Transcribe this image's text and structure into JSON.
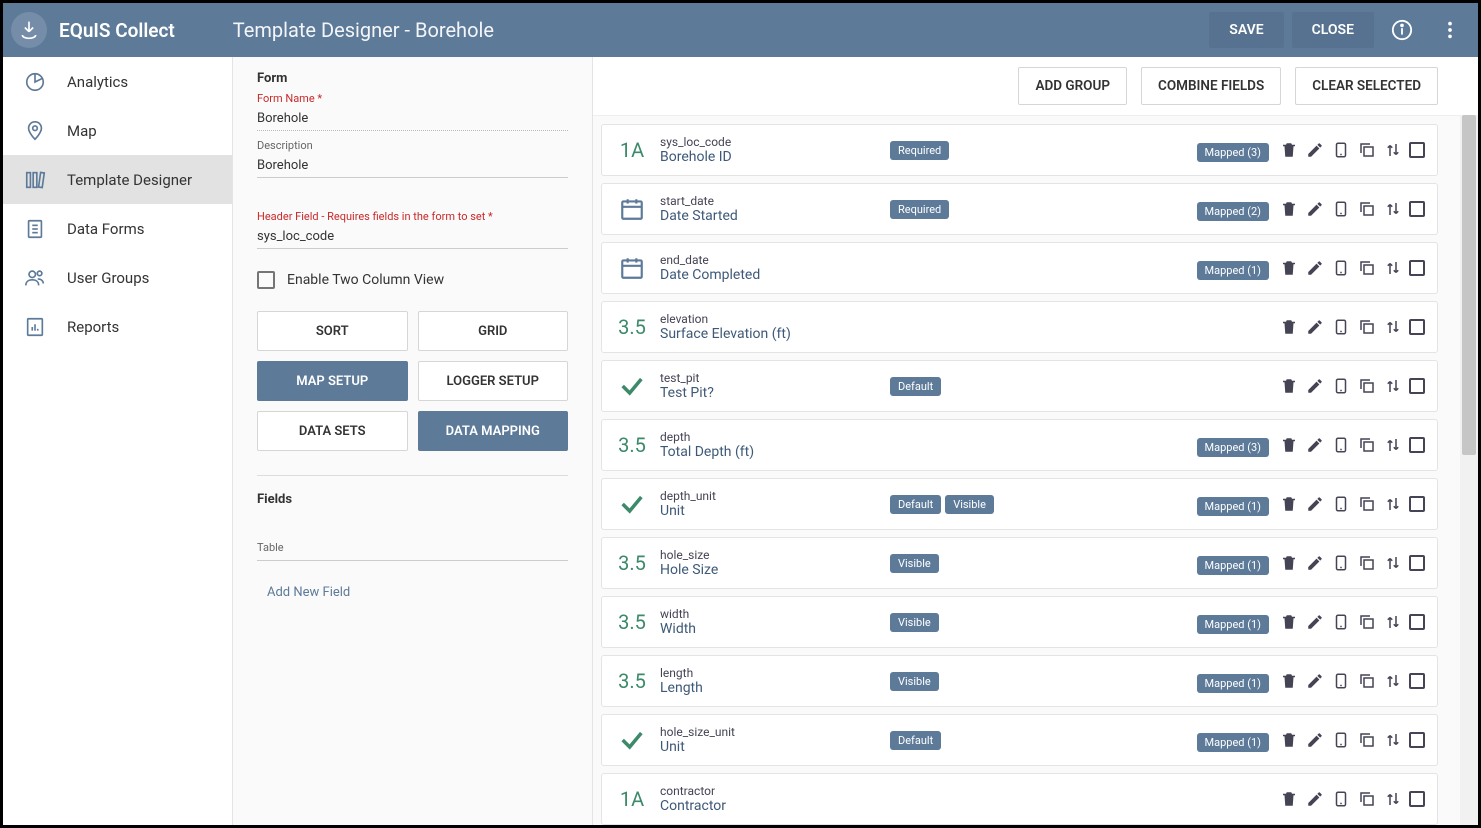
{
  "brand": "EQuIS Collect",
  "page_title": "Template Designer - Borehole",
  "top_actions": {
    "save": "SAVE",
    "close": "CLOSE"
  },
  "nav": [
    {
      "label": "Analytics",
      "icon": "pie"
    },
    {
      "label": "Map",
      "icon": "map"
    },
    {
      "label": "Template Designer",
      "icon": "templates",
      "active": true
    },
    {
      "label": "Data Forms",
      "icon": "forms"
    },
    {
      "label": "User Groups",
      "icon": "users"
    },
    {
      "label": "Reports",
      "icon": "reports"
    }
  ],
  "form": {
    "section": "Form",
    "name_label": "Form Name *",
    "name_value": "Borehole",
    "desc_label": "Description",
    "desc_value": "Borehole",
    "header_label": "Header Field - Requires fields in the form to set *",
    "header_value": "sys_loc_code",
    "twocol_label": "Enable Two Column View",
    "buttons": {
      "sort": "SORT",
      "grid": "GRID",
      "map_setup": "MAP SETUP",
      "logger_setup": "LOGGER SETUP",
      "data_sets": "DATA SETS",
      "data_mapping": "DATA MAPPING"
    },
    "fields_section": "Fields",
    "table_label": "Table",
    "add_field": "Add New Field"
  },
  "toolbar": {
    "add_group": "ADD GROUP",
    "combine": "COMBINE FIELDS",
    "clear": "CLEAR SELECTED"
  },
  "fields": [
    {
      "type": "1A",
      "code": "sys_loc_code",
      "caption": "Borehole ID",
      "tags": [
        "Required"
      ],
      "mapped": "Mapped  (3)"
    },
    {
      "type": "date",
      "code": "start_date",
      "caption": "Date Started",
      "tags": [
        "Required"
      ],
      "mapped": "Mapped  (2)"
    },
    {
      "type": "date",
      "code": "end_date",
      "caption": "Date Completed",
      "tags": [],
      "mapped": "Mapped  (1)"
    },
    {
      "type": "3.5",
      "code": "elevation",
      "caption": "Surface Elevation (ft)",
      "tags": [],
      "mapped": ""
    },
    {
      "type": "check",
      "code": "test_pit",
      "caption": "Test Pit?",
      "tags": [
        "Default"
      ],
      "mapped": ""
    },
    {
      "type": "3.5",
      "code": "depth",
      "caption": "Total Depth (ft)",
      "tags": [],
      "mapped": "Mapped  (3)"
    },
    {
      "type": "check",
      "code": "depth_unit",
      "caption": "Unit",
      "tags": [
        "Default",
        "Visible"
      ],
      "mapped": "Mapped  (1)"
    },
    {
      "type": "3.5",
      "code": "hole_size",
      "caption": "Hole Size",
      "tags": [
        "Visible"
      ],
      "mapped": "Mapped  (1)"
    },
    {
      "type": "3.5",
      "code": "width",
      "caption": "Width",
      "tags": [
        "Visible"
      ],
      "mapped": "Mapped  (1)"
    },
    {
      "type": "3.5",
      "code": "length",
      "caption": "Length",
      "tags": [
        "Visible"
      ],
      "mapped": "Mapped  (1)"
    },
    {
      "type": "check",
      "code": "hole_size_unit",
      "caption": "Unit",
      "tags": [
        "Default"
      ],
      "mapped": "Mapped  (1)"
    },
    {
      "type": "1A",
      "code": "contractor",
      "caption": "Contractor",
      "tags": [],
      "mapped": ""
    }
  ]
}
